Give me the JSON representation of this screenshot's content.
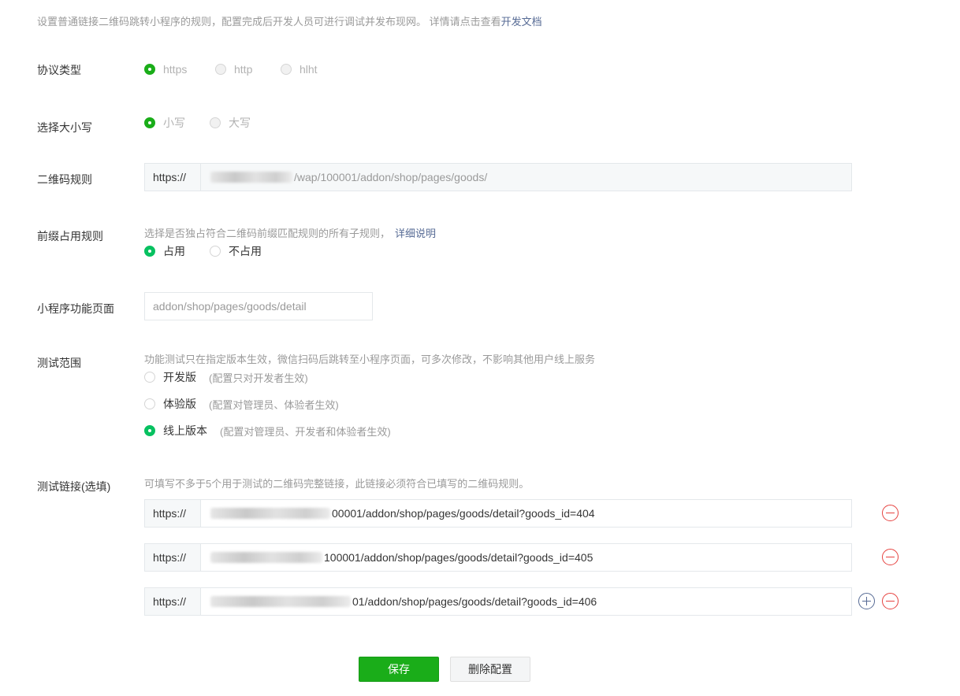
{
  "intro": {
    "text": "设置普通链接二维码跳转小程序的规则，配置完成后开发人员可进行调试并发布现网。 详情请点击查看",
    "link": "开发文档"
  },
  "protocol": {
    "label": "协议类型",
    "options": [
      "https",
      "http",
      "hlht"
    ],
    "selected": "https"
  },
  "case": {
    "label": "选择大小写",
    "options": [
      "小写",
      "大写"
    ],
    "selected": "小写"
  },
  "qr_rule": {
    "label": "二维码规则",
    "prefix": "https://",
    "value": "/wap/100001/addon/shop/pages/goods/"
  },
  "prefix_rule": {
    "label": "前缀占用规则",
    "hint": "选择是否独占符合二维码前缀匹配规则的所有子规则，",
    "hint_link": "详细说明",
    "options": [
      "占用",
      "不占用"
    ],
    "selected": "占用"
  },
  "mini_page": {
    "label": "小程序功能页面",
    "placeholder": "addon/shop/pages/goods/detail"
  },
  "test_scope": {
    "label": "测试范围",
    "hint": "功能测试只在指定版本生效，微信扫码后跳转至小程序页面，可多次修改，不影响其他用户线上服务",
    "options": [
      {
        "name": "开发版",
        "note": "(配置只对开发者生效)"
      },
      {
        "name": "体验版",
        "note": "(配置对管理员、体验者生效)"
      },
      {
        "name": "线上版本",
        "note": "(配置对管理员、开发者和体验者生效)"
      }
    ],
    "selected": "线上版本"
  },
  "test_links": {
    "label": "测试链接(选填)",
    "hint": "可填写不多于5个用于测试的二维码完整链接，此链接必须符合已填写的二维码规则。",
    "prefix": "https://",
    "links": [
      "00001/addon/shop/pages/goods/detail?goods_id=404",
      "100001/addon/shop/pages/goods/detail?goods_id=405",
      "01/addon/shop/pages/goods/detail?goods_id=406"
    ]
  },
  "buttons": {
    "save": "保存",
    "delete": "删除配置"
  },
  "colors": {
    "primary_green": "#1aad19",
    "radio_green": "#07c160",
    "link_blue": "#576b95",
    "danger_red": "#e64340"
  }
}
